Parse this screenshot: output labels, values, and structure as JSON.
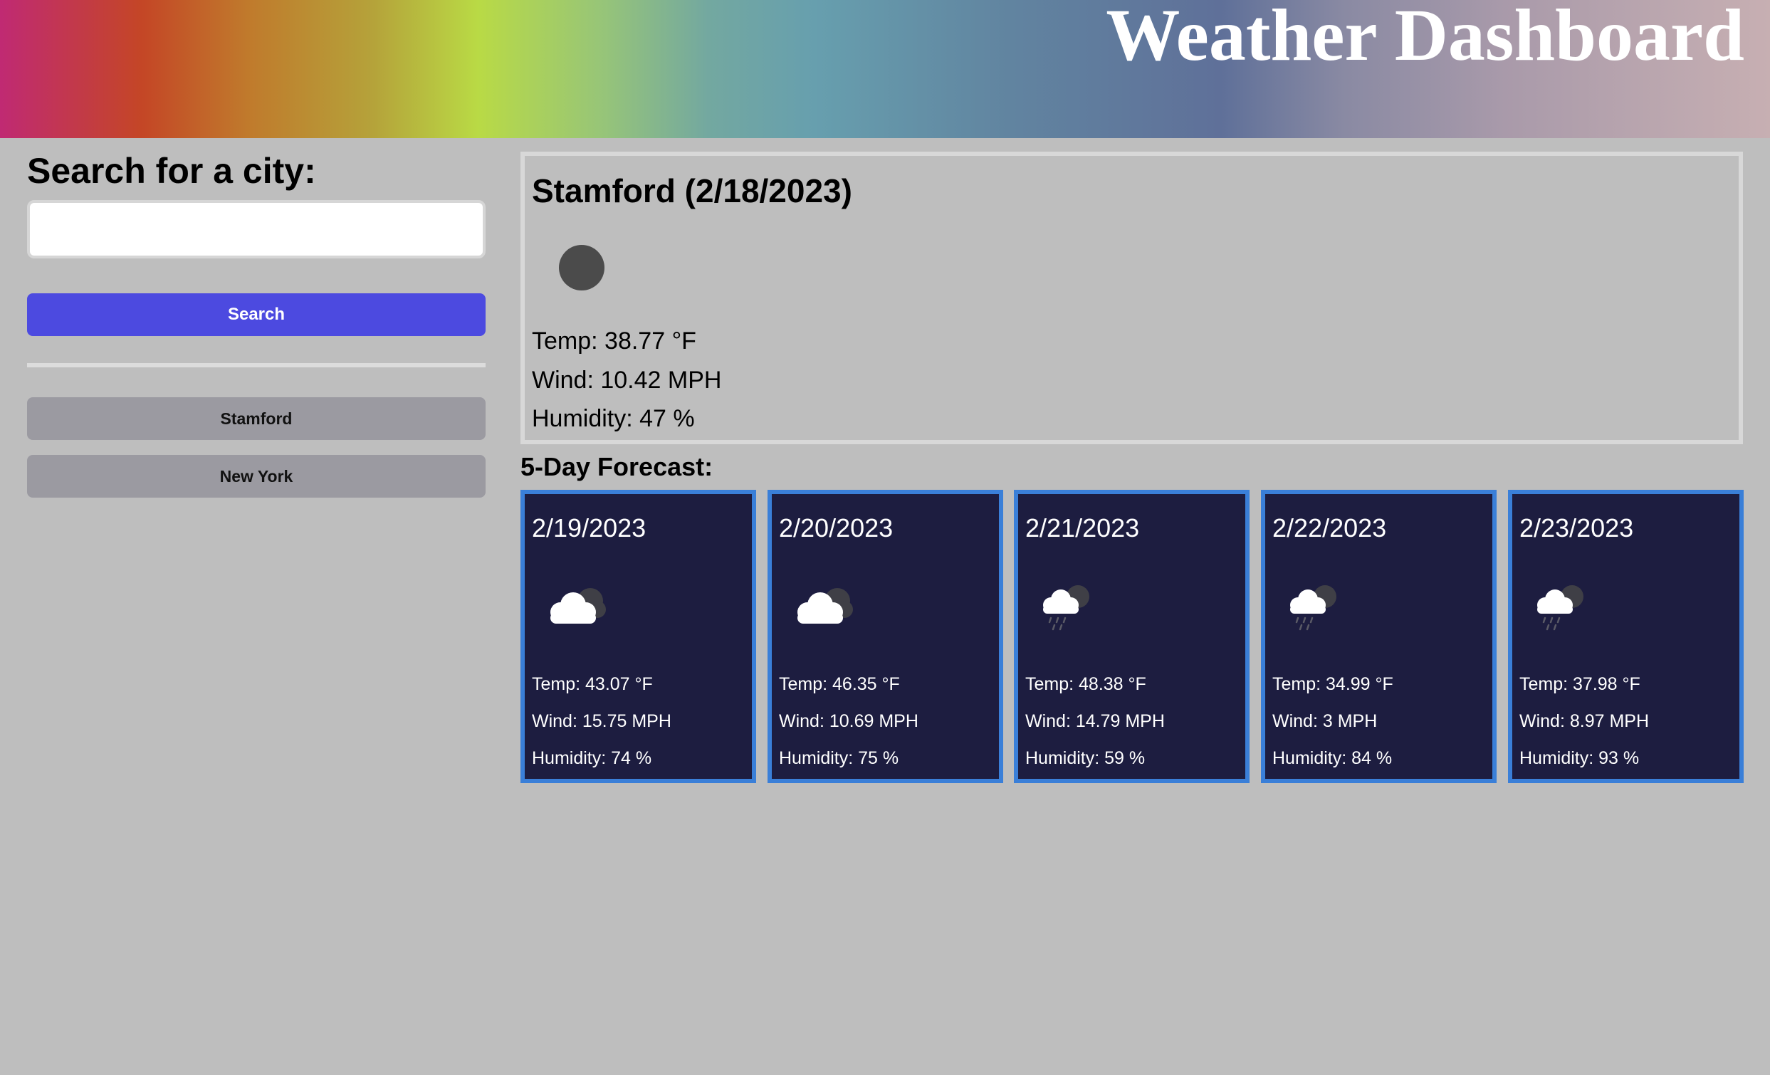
{
  "header": {
    "title": "Weather Dashboard"
  },
  "sidebar": {
    "heading": "Search for a city:",
    "search_value": "",
    "search_button": "Search",
    "history": [
      "Stamford",
      "New York"
    ]
  },
  "current": {
    "title": "Stamford  (2/18/2023)",
    "icon": "dark-circle-icon",
    "temp": "Temp: 38.77 °F",
    "wind": "Wind: 10.42 MPH",
    "humidity": "Humidity: 47 %"
  },
  "forecast": {
    "title": "5-Day Forecast:",
    "days": [
      {
        "date": "2/19/2023",
        "icon": "cloudy-night-icon",
        "temp": "Temp: 43.07 °F",
        "wind": "Wind: 15.75 MPH",
        "humidity": "Humidity: 74 %"
      },
      {
        "date": "2/20/2023",
        "icon": "cloudy-night-icon",
        "temp": "Temp: 46.35 °F",
        "wind": "Wind: 10.69 MPH",
        "humidity": "Humidity: 75 %"
      },
      {
        "date": "2/21/2023",
        "icon": "rain-night-icon",
        "temp": "Temp: 48.38 °F",
        "wind": "Wind: 14.79 MPH",
        "humidity": "Humidity: 59 %"
      },
      {
        "date": "2/22/2023",
        "icon": "rain-night-icon",
        "temp": "Temp: 34.99 °F",
        "wind": "Wind: 3 MPH",
        "humidity": "Humidity: 84 %"
      },
      {
        "date": "2/23/2023",
        "icon": "rain-night-icon",
        "temp": "Temp: 37.98 °F",
        "wind": "Wind: 8.97 MPH",
        "humidity": "Humidity: 93 %"
      }
    ]
  }
}
